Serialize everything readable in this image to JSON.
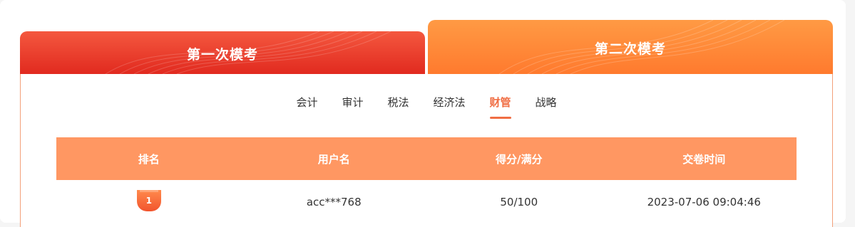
{
  "tabs": [
    {
      "label": "第一次模考",
      "active": false
    },
    {
      "label": "第二次模考",
      "active": true
    }
  ],
  "subjects": [
    {
      "label": "会计",
      "active": false
    },
    {
      "label": "审计",
      "active": false
    },
    {
      "label": "税法",
      "active": false
    },
    {
      "label": "经济法",
      "active": false
    },
    {
      "label": "财管",
      "active": true
    },
    {
      "label": "战略",
      "active": false
    }
  ],
  "table": {
    "headers": [
      "排名",
      "用户名",
      "得分/满分",
      "交卷时间"
    ],
    "rows": [
      {
        "rank": "1",
        "username": "acc***768",
        "score": "50/100",
        "submit_time": "2023-07-06 09:04:46"
      }
    ]
  },
  "colors": {
    "tab_first": "#e12a1f",
    "tab_second": "#ff8a38",
    "accent": "#f06e44",
    "table_header": "#ff9762"
  }
}
